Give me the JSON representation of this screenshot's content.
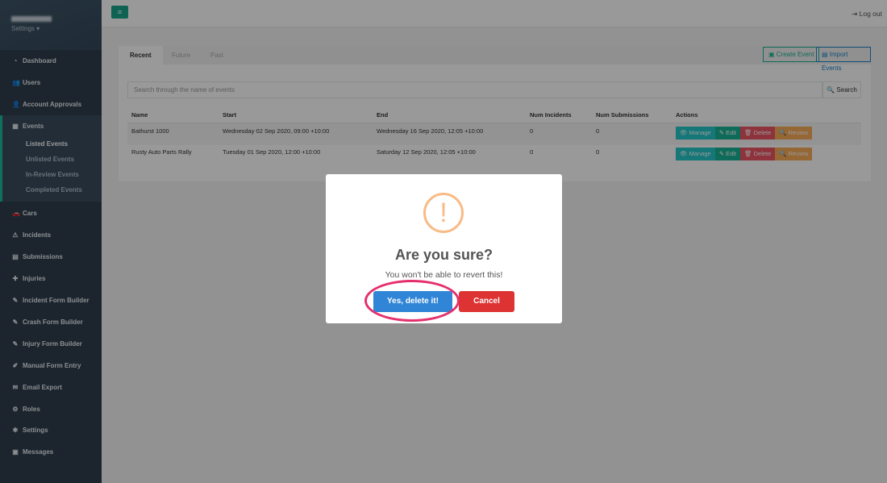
{
  "sidebar": {
    "settings_label": "Settings ▾",
    "items": [
      {
        "label": "Dashboard",
        "icon": "dashboard-icon",
        "glyph": "◔"
      },
      {
        "label": "Users",
        "icon": "users-icon",
        "glyph": "👥"
      },
      {
        "label": "Account Approvals",
        "icon": "user-plus-icon",
        "glyph": "👤"
      },
      {
        "label": "Events",
        "icon": "calendar-icon",
        "glyph": "▦"
      },
      {
        "label": "Cars",
        "icon": "car-icon",
        "glyph": "🚗"
      },
      {
        "label": "Incidents",
        "icon": "incident-icon",
        "glyph": "⚠"
      },
      {
        "label": "Submissions",
        "icon": "file-icon",
        "glyph": "▤"
      },
      {
        "label": "Injuries",
        "icon": "ambulance-icon",
        "glyph": "✚"
      },
      {
        "label": "Incident Form Builder",
        "icon": "wrench-icon",
        "glyph": "✎"
      },
      {
        "label": "Crash Form Builder",
        "icon": "wrench-icon",
        "glyph": "✎"
      },
      {
        "label": "Injury Form Builder",
        "icon": "wrench-icon",
        "glyph": "✎"
      },
      {
        "label": "Manual Form Entry",
        "icon": "edit-icon",
        "glyph": "✐"
      },
      {
        "label": "Email Export",
        "icon": "envelope-icon",
        "glyph": "✉"
      },
      {
        "label": "Roles",
        "icon": "user-cog-icon",
        "glyph": "⚙"
      },
      {
        "label": "Settings",
        "icon": "gear-icon",
        "glyph": "✱"
      },
      {
        "label": "Messages",
        "icon": "message-icon",
        "glyph": "▣"
      }
    ],
    "event_subitems": [
      "Listed Events",
      "Unlisted Events",
      "In-Review Events",
      "Completed Events"
    ],
    "active_subitem": "Listed Events"
  },
  "topbar": {
    "menu_glyph": "≡",
    "logout_label": "⇥ Log out"
  },
  "tabs": [
    "Recent",
    "Future",
    "Past"
  ],
  "active_tab": "Recent",
  "buttons": {
    "create_event": "▣ Create Event",
    "import_events": "▤ Import Events"
  },
  "search": {
    "placeholder": "Search through the name of events",
    "button": "🔍 Search"
  },
  "table": {
    "headers": [
      "Name",
      "Start",
      "End",
      "Num Incidents",
      "Num Submissions",
      "Actions"
    ],
    "rows": [
      [
        "Bathurst 1000",
        "Wednesday 02 Sep 2020, 09:00 +10:00",
        "Wednesday 16 Sep 2020, 12:05 +10:00",
        "0",
        "0"
      ],
      [
        "Rusty Auto Parts Rally",
        "Tuesday 01 Sep 2020, 12:00 +10:00",
        "Saturday 12 Sep 2020, 12:05 +10:00",
        "0",
        "0"
      ]
    ],
    "actions": [
      "👁 Manage",
      "✎ Edit",
      "🗑 Delete",
      "🔍 Review"
    ]
  },
  "modal": {
    "icon": "!",
    "title": "Are you sure?",
    "text": "You won't be able to revert this!",
    "confirm": "Yes, delete it!",
    "cancel": "Cancel"
  },
  "colors": {
    "accent": "#1abc9c",
    "manage": "#23c6c8",
    "edit": "#1ab394",
    "delete": "#ed5565",
    "review": "#f8ac59",
    "confirm": "#3085d6",
    "cancel": "#dd3333",
    "highlight": "#e5306e"
  }
}
